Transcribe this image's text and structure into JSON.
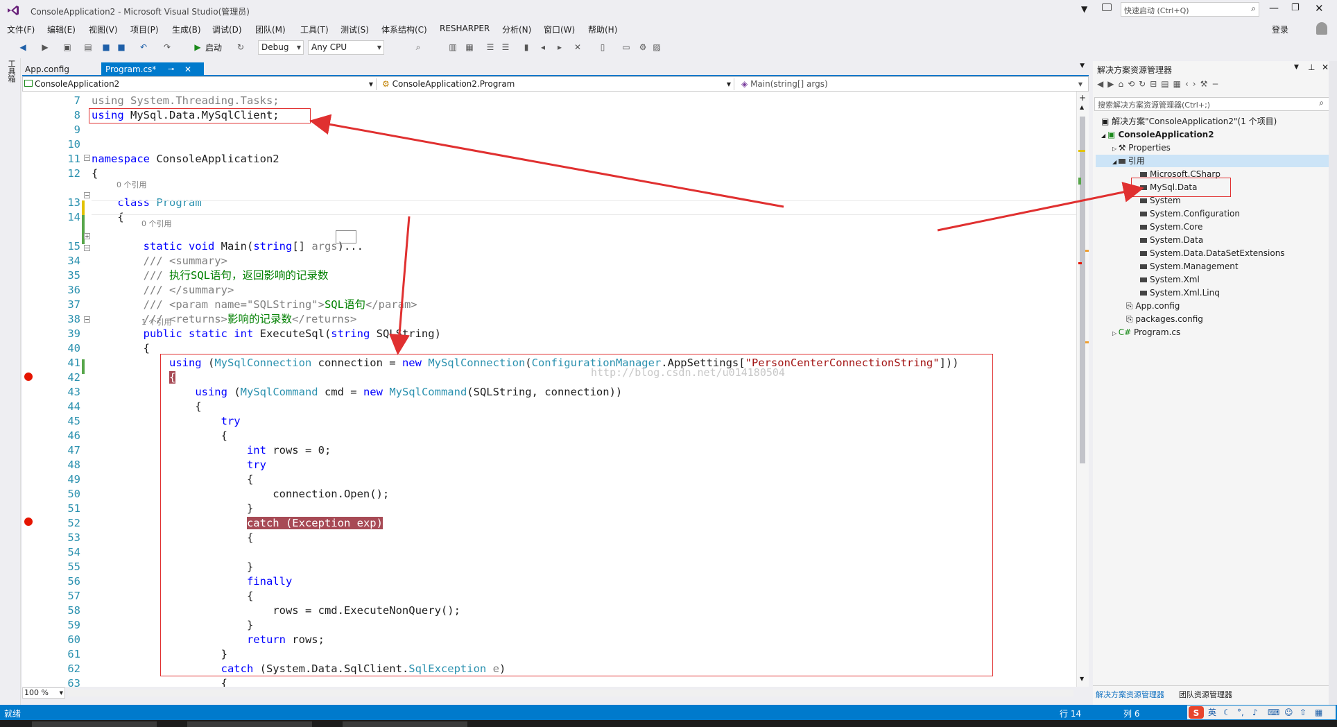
{
  "window": {
    "title": "ConsoleApplication2 - Microsoft Visual Studio(管理员)",
    "quick_launch_placeholder": "快速启动 (Ctrl+Q)",
    "login_label": "登录"
  },
  "menu": [
    "文件(F)",
    "编辑(E)",
    "视图(V)",
    "项目(P)",
    "生成(B)",
    "调试(D)",
    "团队(M)",
    "工具(T)",
    "测试(S)",
    "体系结构(C)",
    "RESHARPER",
    "分析(N)",
    "窗口(W)",
    "帮助(H)"
  ],
  "toolbar": {
    "start_label": "启动",
    "config": "Debug",
    "platform": "Any CPU"
  },
  "left_tool_label": "工具箱",
  "tabs": [
    {
      "label": "App.config"
    },
    {
      "label": "Program.cs*"
    }
  ],
  "navbar": {
    "project": "ConsoleApplication2",
    "type": "ConsoleApplication2.Program",
    "member": "Main(string[] args)"
  },
  "code_lines": [
    {
      "n": "7",
      "html": "<span class=\"dim\">using System.Threading.Tasks;</span>"
    },
    {
      "n": "8",
      "html": "<span class=\"kw\">using</span> MySql.Data.MySqlClient;"
    },
    {
      "n": "9",
      "html": ""
    },
    {
      "n": "10",
      "html": ""
    },
    {
      "n": "11",
      "html": "<span class=\"kw\">namespace</span> ConsoleApplication2"
    },
    {
      "n": "12",
      "html": "{"
    },
    {
      "n": "13",
      "html": "    <span class=\"kw\">class</span> <span class=\"ty\">Program</span>"
    },
    {
      "n": "14",
      "html": "    {"
    },
    {
      "n": "15",
      "html": "        <span class=\"kw\">static void</span> Main(<span class=\"kw\">string</span>[] <span class=\"dim\">args</span>)..."
    },
    {
      "n": "34",
      "html": "        <span class=\"dim\">/// &lt;summary&gt;</span>"
    },
    {
      "n": "35",
      "html": "        <span class=\"dim\">///</span> <span class=\"cm\">执行SQL语句，返回影响的记录数</span>"
    },
    {
      "n": "36",
      "html": "        <span class=\"dim\">/// &lt;/summary&gt;</span>"
    },
    {
      "n": "37",
      "html": "        <span class=\"dim\">/// &lt;param name=\"SQLString\"&gt;</span><span class=\"cm\">SQL语句</span><span class=\"dim\">&lt;/param&gt;</span>"
    },
    {
      "n": "38",
      "html": "        <span class=\"dim\">/// &lt;returns&gt;</span><span class=\"cm\">影响的记录数</span><span class=\"dim\">&lt;/returns&gt;</span>"
    },
    {
      "n": "39",
      "html": "        <span class=\"kw\">public static int</span> ExecuteSql(<span class=\"kw\">string</span> SQLString)"
    },
    {
      "n": "40",
      "html": "        {"
    },
    {
      "n": "41",
      "html": "            <span class=\"kw\">using</span> (<span class=\"ty\">MySqlConnection</span> connection = <span class=\"kw\">new</span> <span class=\"ty\">MySqlConnection</span>(<span class=\"ty\">ConfigurationManager</span>.AppSettings[<span class=\"st\">\"PersonCenterConnectionString\"</span>]))"
    },
    {
      "n": "42",
      "html": "            <span style=\"background:#a74a55;color:#fff\">{</span>"
    },
    {
      "n": "43",
      "html": "                <span class=\"kw\">using</span> (<span class=\"ty\">MySqlCommand</span> cmd = <span class=\"kw\">new</span> <span class=\"ty\">MySqlCommand</span>(SQLString, connection))"
    },
    {
      "n": "44",
      "html": "                {"
    },
    {
      "n": "45",
      "html": "                    <span class=\"kw\">try</span>"
    },
    {
      "n": "46",
      "html": "                    {"
    },
    {
      "n": "47",
      "html": "                        <span class=\"kw\">int</span> rows = 0;"
    },
    {
      "n": "48",
      "html": "                        <span class=\"kw\">try</span>"
    },
    {
      "n": "49",
      "html": "                        {"
    },
    {
      "n": "50",
      "html": "                            connection.Open();"
    },
    {
      "n": "51",
      "html": "                        }"
    },
    {
      "n": "52",
      "html": "                        <span style=\"background:#a74a55;color:#fff\">catch (Exception exp)</span>"
    },
    {
      "n": "53",
      "html": "                        {"
    },
    {
      "n": "54",
      "html": ""
    },
    {
      "n": "55",
      "html": "                        }"
    },
    {
      "n": "56",
      "html": "                        <span class=\"kw\">finally</span>"
    },
    {
      "n": "57",
      "html": "                        {"
    },
    {
      "n": "58",
      "html": "                            rows = cmd.ExecuteNonQuery();"
    },
    {
      "n": "59",
      "html": "                        }"
    },
    {
      "n": "60",
      "html": "                        <span class=\"kw\">return</span> rows;"
    },
    {
      "n": "61",
      "html": "                    }"
    },
    {
      "n": "62",
      "html": "                    <span class=\"kw\">catch</span> (System.Data.SqlClient.<span class=\"ty\">SqlException</span> <span class=\"dim\">e</span>)"
    },
    {
      "n": "63",
      "html": "                    {"
    }
  ],
  "codelens": {
    "ref0": "0 个引用",
    "ref1": "1 个引用"
  },
  "watermark": "http://blog.csdn.net/u014180504",
  "zoom": "100 %",
  "solution_explorer": {
    "title": "解决方案资源管理器",
    "search_placeholder": "搜索解决方案资源管理器(Ctrl+;)",
    "items": [
      "解决方案\"ConsoleApplication2\"(1 个项目)",
      "ConsoleApplication2",
      "Properties",
      "引用",
      "Microsoft.CSharp",
      "MySql.Data",
      "System",
      "System.Configuration",
      "System.Core",
      "System.Data",
      "System.Data.DataSetExtensions",
      "System.Management",
      "System.Xml",
      "System.Xml.Linq",
      "App.config",
      "packages.config",
      "Program.cs"
    ],
    "bottom_tabs": [
      "解决方案资源管理器",
      "团队资源管理器"
    ]
  },
  "status": {
    "ready": "就绪",
    "line": "行 14",
    "col": "列 6",
    "ime": "英"
  }
}
